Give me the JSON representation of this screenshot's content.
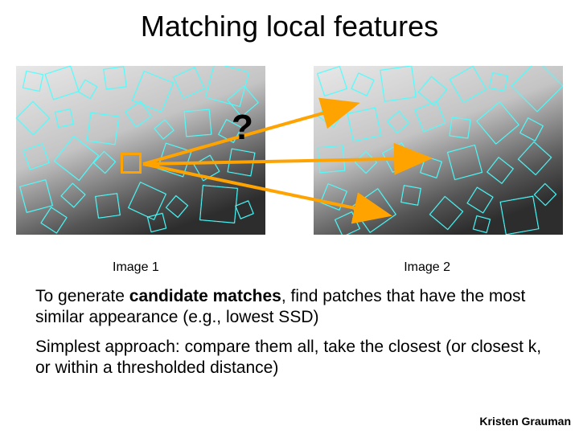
{
  "title": "Matching local features",
  "question_mark": "?",
  "image1_caption": "Image 1",
  "image2_caption": "Image 2",
  "paragraph1_pre": "To generate ",
  "paragraph1_bold": "candidate matches",
  "paragraph1_post": ", find patches that have the most similar appearance (e.g., lowest SSD)",
  "paragraph2": "Simplest approach: compare them all, take the closest (or closest k, or within a thresholded distance)",
  "attribution": "Kristen Grauman"
}
